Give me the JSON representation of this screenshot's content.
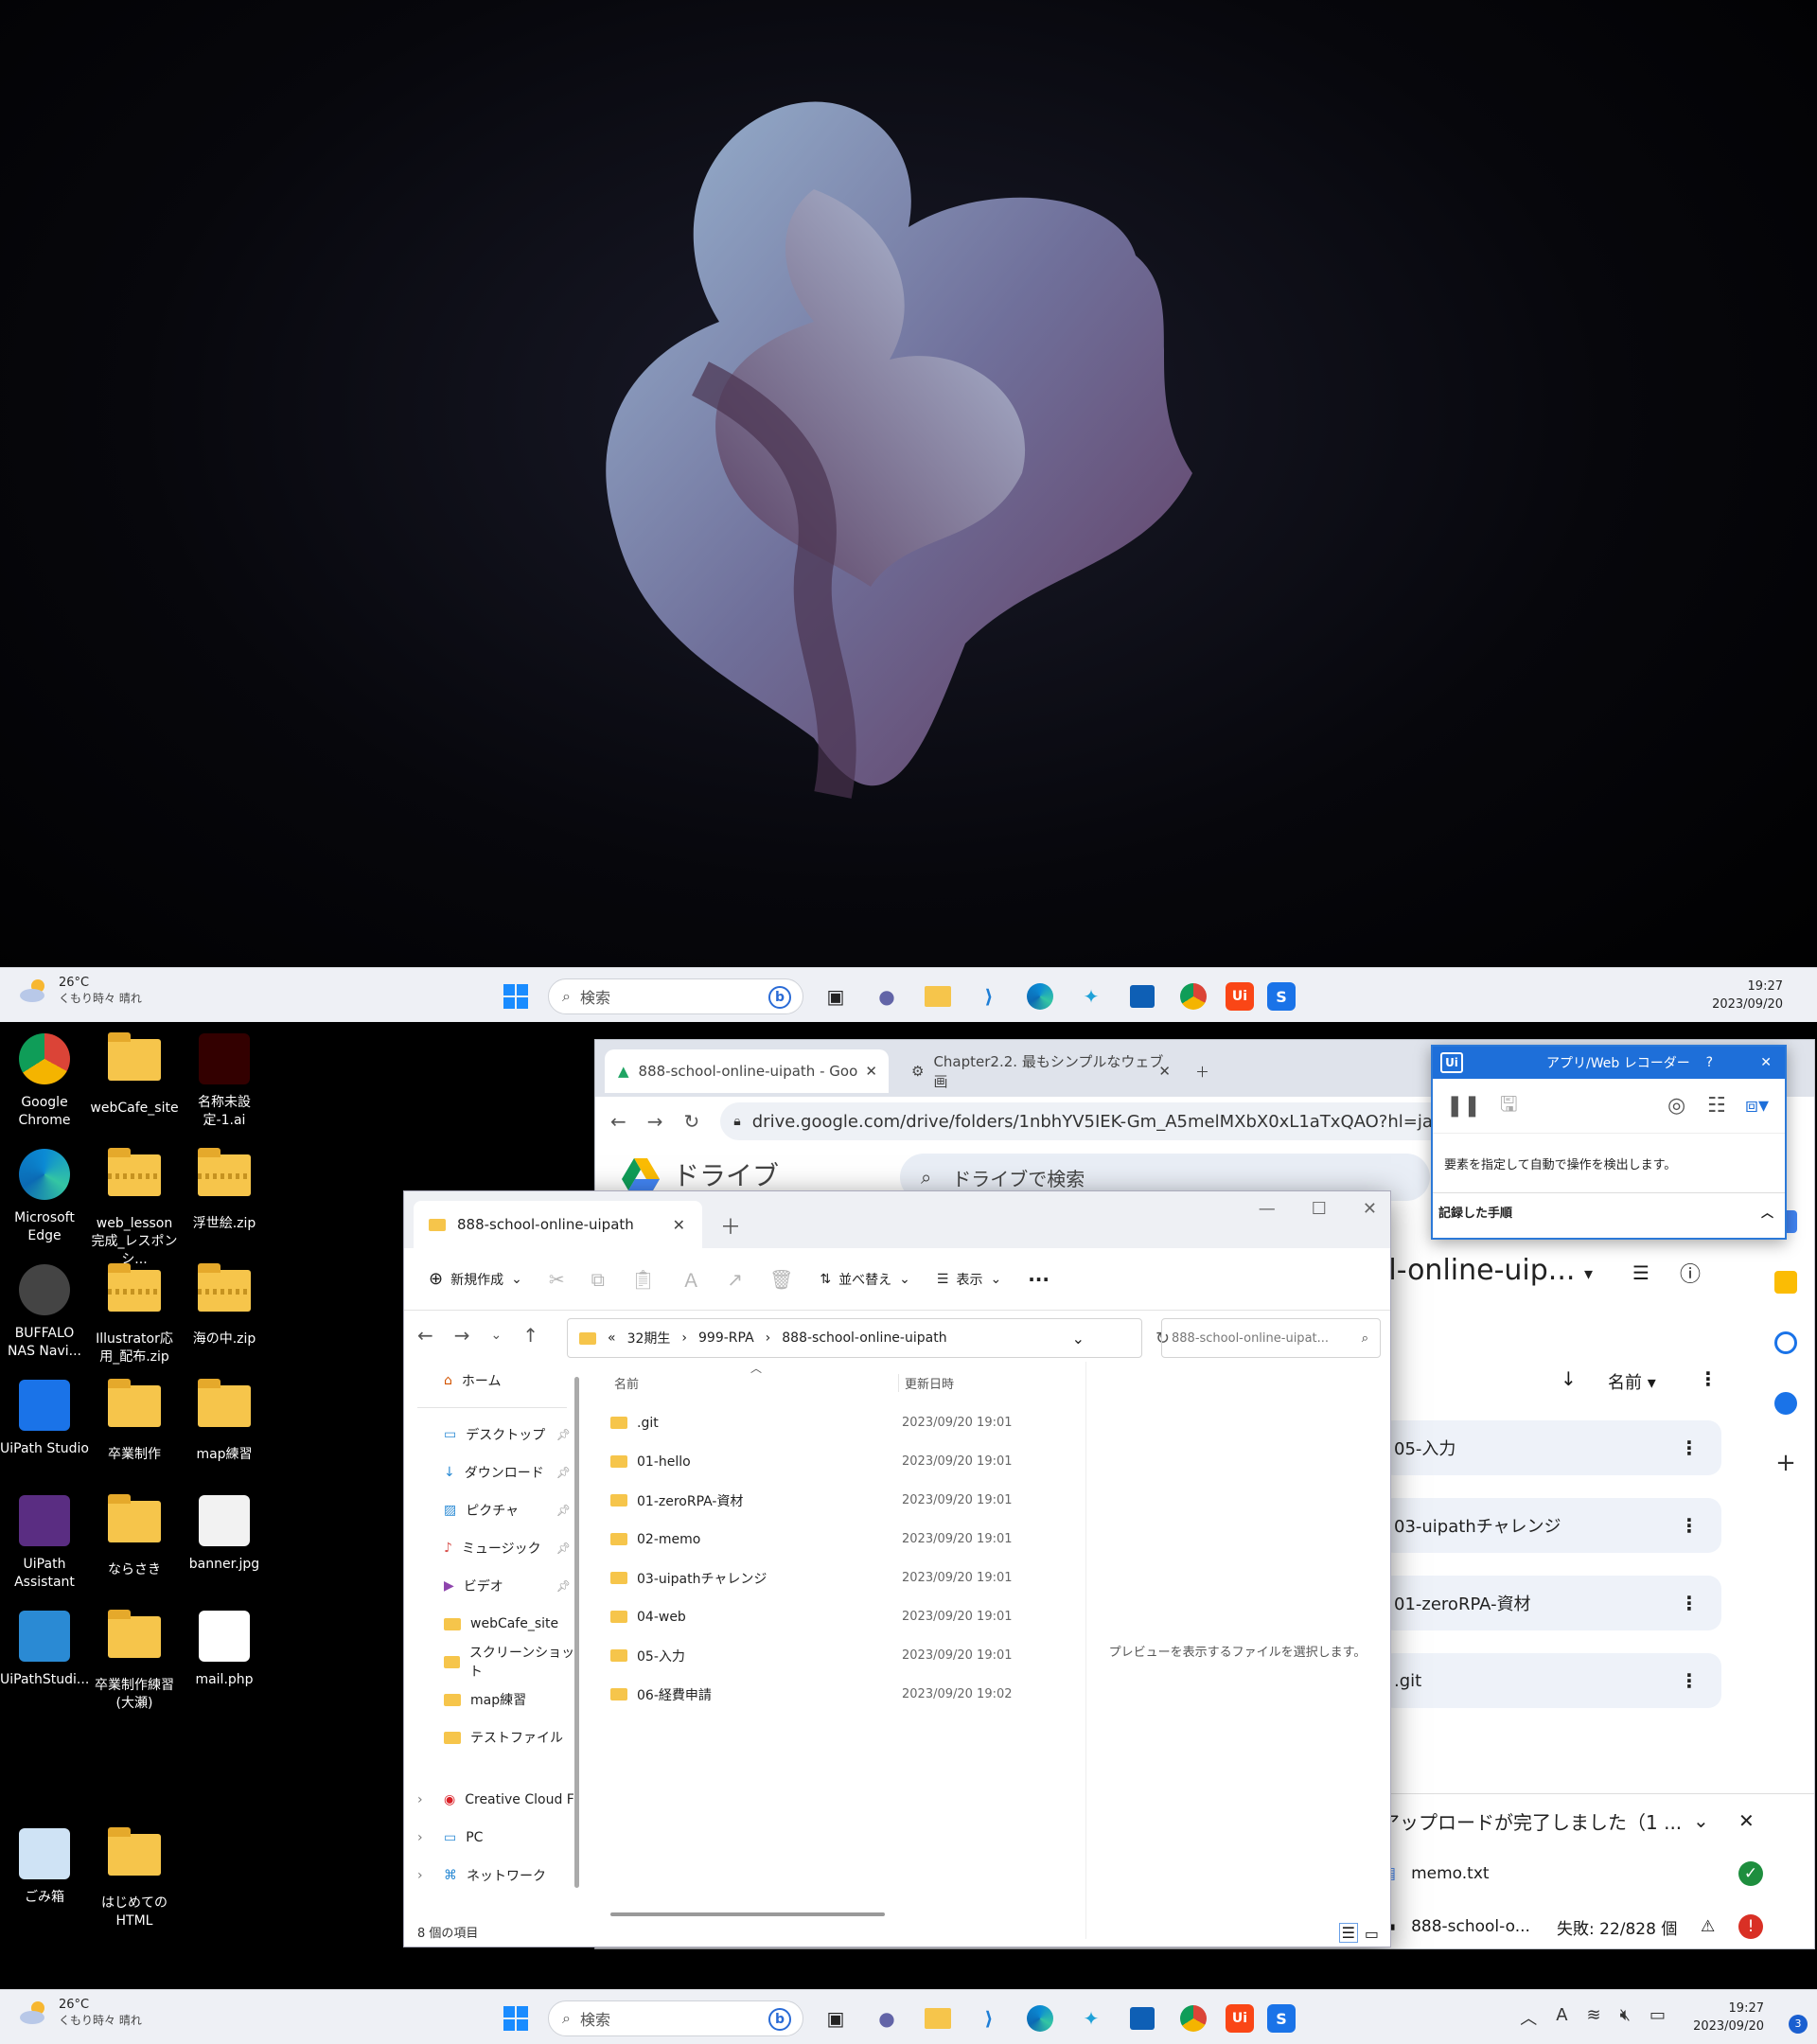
{
  "taskbar": {
    "temp": "26°C",
    "weather": "くもり時々 晴れ",
    "search_placeholder": "検索",
    "time": "19:27",
    "date": "2023/09/20",
    "notifications": "3"
  },
  "desktop_icons": [
    {
      "label": "Google Chrome",
      "icon": "chrome-icon"
    },
    {
      "label": "webCafe_site",
      "icon": "folder-icon"
    },
    {
      "label": "名称未設定-1.ai",
      "icon": "illustrator-icon"
    },
    {
      "label": "Microsoft Edge",
      "icon": "edge-icon"
    },
    {
      "label": "web_lesson完成_レスポンシ...",
      "icon": "zip-folder-icon"
    },
    {
      "label": "浮世絵.zip",
      "icon": "zip-folder-icon"
    },
    {
      "label": "BUFFALO NAS Navi...",
      "icon": "buffalo-icon"
    },
    {
      "label": "Illustrator応用_配布.zip",
      "icon": "zip-folder-icon"
    },
    {
      "label": "海の中.zip",
      "icon": "zip-folder-icon"
    },
    {
      "label": "UiPath Studio",
      "icon": "uipath-studio-icon"
    },
    {
      "label": "卒業制作",
      "icon": "folder-icon"
    },
    {
      "label": "map練習",
      "icon": "folder-icon"
    },
    {
      "label": "UiPath Assistant",
      "icon": "uipath-assistant-icon"
    },
    {
      "label": "ならさき",
      "icon": "folder-icon"
    },
    {
      "label": "banner.jpg",
      "icon": "image-file-icon"
    },
    {
      "label": "UiPathStudi...",
      "icon": "uipath-studio-web-icon"
    },
    {
      "label": "卒業制作練習(大瀬)",
      "icon": "folder-icon"
    },
    {
      "label": "mail.php",
      "icon": "php-file-icon"
    },
    {
      "label": "ごみ箱",
      "icon": "recycle-bin-icon"
    },
    {
      "label": "はじめてのHTML",
      "icon": "folder-icon"
    }
  ],
  "chrome": {
    "tab1": "888-school-online-uipath - Goo",
    "tab2": "Chapter2.2. 最もシンプルなウェブ画",
    "url": "drive.google.com/drive/folders/1nbhYV5IEK-Gm_A5melMXbX0xL1aTxQAO?hl=ja",
    "app_name": "ドライブ",
    "search_placeholder": "ドライブで検索",
    "folder_title": "ol-online-uip...",
    "sort_label": "名前",
    "rows": [
      "05-入力",
      "03-uipathチャレンジ",
      "01-zeroRPA-資材",
      ".git"
    ],
    "upload_title": "アップロードが完了しました（1 ...",
    "upload_file1": "memo.txt",
    "upload_file2": "888-school-o...",
    "upload_fail": "失敗: 22/828 個"
  },
  "explorer": {
    "tab_title": "888-school-online-uipath",
    "new_label": "新規作成",
    "sort_label": "並べ替え",
    "view_label": "表示",
    "path": [
      "«",
      "32期生",
      "999-RPA",
      "888-school-online-uipath"
    ],
    "search_placeholder": "888-school-online-uipat...",
    "sidebar": {
      "home": "ホーム",
      "pinned": [
        "デスクトップ",
        "ダウンロード",
        "ピクチャ",
        "ミュージック",
        "ビデオ"
      ],
      "folders": [
        "webCafe_site",
        "スクリーンショット",
        "map練習",
        "テストファイル"
      ],
      "bottom": [
        "Creative Cloud F",
        "PC",
        "ネットワーク"
      ]
    },
    "col_name": "名前",
    "col_date": "更新日時",
    "files": [
      {
        "name": ".git",
        "date": "2023/09/20 19:01"
      },
      {
        "name": "01-hello",
        "date": "2023/09/20 19:01"
      },
      {
        "name": "01-zeroRPA-資材",
        "date": "2023/09/20 19:01"
      },
      {
        "name": "02-memo",
        "date": "2023/09/20 19:01"
      },
      {
        "name": "03-uipathチャレンジ",
        "date": "2023/09/20 19:01"
      },
      {
        "name": "04-web",
        "date": "2023/09/20 19:01"
      },
      {
        "name": "05-入力",
        "date": "2023/09/20 19:01"
      },
      {
        "name": "06-経費申請",
        "date": "2023/09/20 19:02"
      }
    ],
    "preview_msg": "プレビューを表示するファイルを選択します。",
    "status": "8 個の項目"
  },
  "recorder": {
    "logo": "Ui",
    "title": "アプリ/Web レコーダー",
    "help": "?",
    "message": "要素を指定して自動で操作を検出します。",
    "steps_label": "記録した手順"
  }
}
